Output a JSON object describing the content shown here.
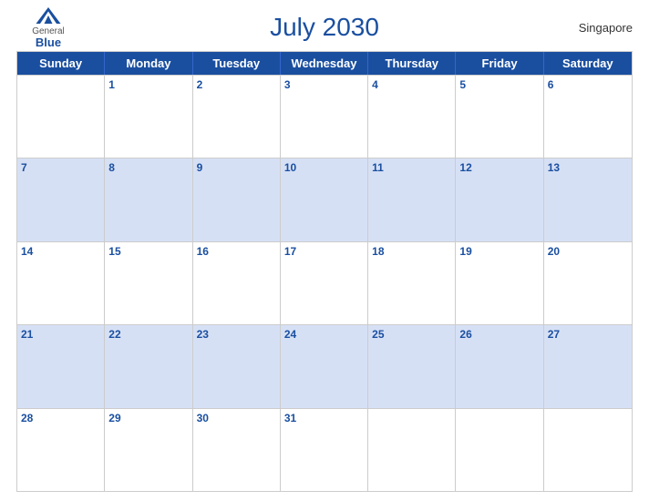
{
  "header": {
    "logo": {
      "general": "General",
      "blue": "Blue",
      "icon_color": "#1a4fa0"
    },
    "title": "July 2030",
    "location": "Singapore"
  },
  "calendar": {
    "days_of_week": [
      "Sunday",
      "Monday",
      "Tuesday",
      "Wednesday",
      "Thursday",
      "Friday",
      "Saturday"
    ],
    "weeks": [
      [
        {
          "day": "",
          "shaded": false
        },
        {
          "day": "1",
          "shaded": false
        },
        {
          "day": "2",
          "shaded": false
        },
        {
          "day": "3",
          "shaded": false
        },
        {
          "day": "4",
          "shaded": false
        },
        {
          "day": "5",
          "shaded": false
        },
        {
          "day": "6",
          "shaded": false
        }
      ],
      [
        {
          "day": "7",
          "shaded": true
        },
        {
          "day": "8",
          "shaded": true
        },
        {
          "day": "9",
          "shaded": true
        },
        {
          "day": "10",
          "shaded": true
        },
        {
          "day": "11",
          "shaded": true
        },
        {
          "day": "12",
          "shaded": true
        },
        {
          "day": "13",
          "shaded": true
        }
      ],
      [
        {
          "day": "14",
          "shaded": false
        },
        {
          "day": "15",
          "shaded": false
        },
        {
          "day": "16",
          "shaded": false
        },
        {
          "day": "17",
          "shaded": false
        },
        {
          "day": "18",
          "shaded": false
        },
        {
          "day": "19",
          "shaded": false
        },
        {
          "day": "20",
          "shaded": false
        }
      ],
      [
        {
          "day": "21",
          "shaded": true
        },
        {
          "day": "22",
          "shaded": true
        },
        {
          "day": "23",
          "shaded": true
        },
        {
          "day": "24",
          "shaded": true
        },
        {
          "day": "25",
          "shaded": true
        },
        {
          "day": "26",
          "shaded": true
        },
        {
          "day": "27",
          "shaded": true
        }
      ],
      [
        {
          "day": "28",
          "shaded": false
        },
        {
          "day": "29",
          "shaded": false
        },
        {
          "day": "30",
          "shaded": false
        },
        {
          "day": "31",
          "shaded": false
        },
        {
          "day": "",
          "shaded": false
        },
        {
          "day": "",
          "shaded": false
        },
        {
          "day": "",
          "shaded": false
        }
      ]
    ]
  }
}
